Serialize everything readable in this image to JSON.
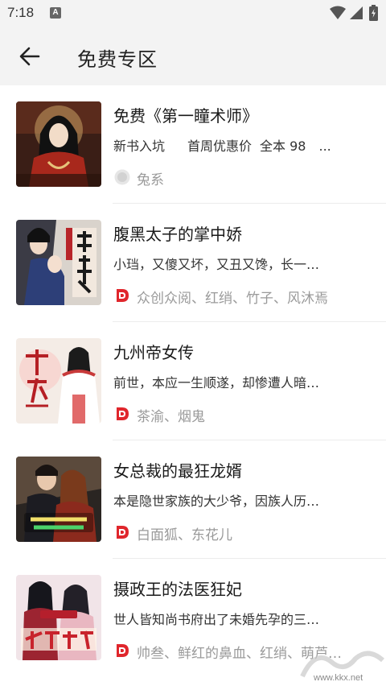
{
  "status_bar": {
    "time": "7:18",
    "notification_badge": "A"
  },
  "header": {
    "title": "免费专区",
    "back_icon": "arrow-left-icon"
  },
  "books": [
    {
      "title": "免费《第一瞳术师》",
      "tags": [
        "新书入坑",
        "首周优惠价",
        "全本 98",
        "..."
      ],
      "author": "兔系",
      "author_icon": "gray-circle-avatar-icon"
    },
    {
      "title": "腹黑太子的掌中娇",
      "description": "小珰，又傻又坏，又丑又馋，长一…",
      "author": "众创众阅、红绡、竹子、风沐焉",
      "author_icon": "red-audio-badge-icon"
    },
    {
      "title": "九州帝女传",
      "description": "前世，本应一生顺遂，却惨遭人暗…",
      "author": "茶渝、烟鬼",
      "author_icon": "red-audio-badge-icon"
    },
    {
      "title": "女总裁的最狂龙婿",
      "description": "本是隐世家族的大少爷，因族人历…",
      "author": "白面狐、东花儿",
      "author_icon": "red-audio-badge-icon"
    },
    {
      "title": "摄政王的法医狂妃",
      "description": "世人皆知尚书府出了未婚先孕的三…",
      "author": "帅叁、鲜红的鼻血、红绡、萌芦…",
      "author_icon": "red-audio-badge-icon"
    }
  ],
  "watermark": {
    "text": "www.kkx.net"
  },
  "colors": {
    "accent": "#e0262c",
    "muted_text": "#9a9a9a",
    "appbar_bg": "#f3f3f3"
  }
}
